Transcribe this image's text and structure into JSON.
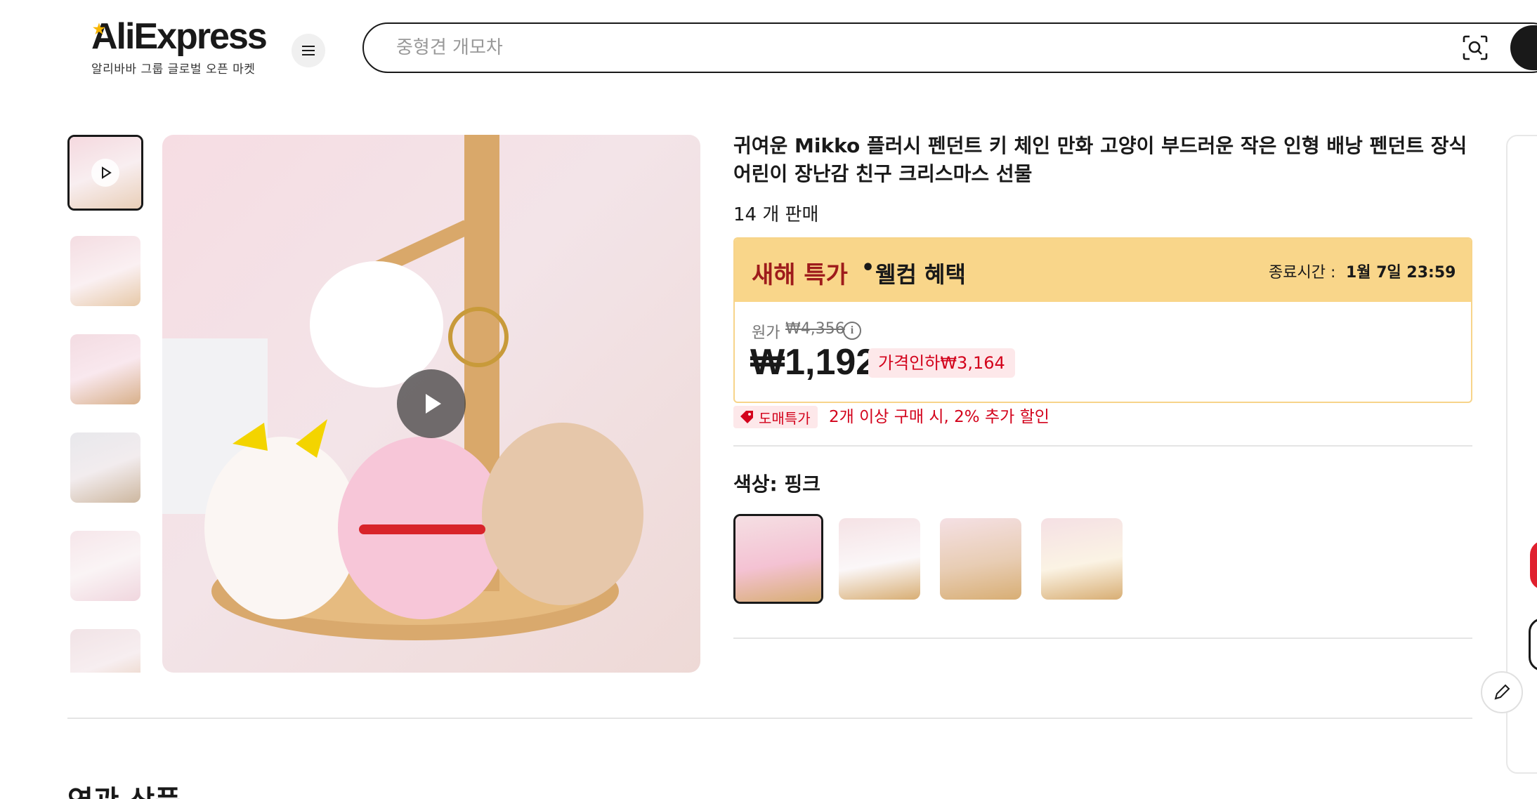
{
  "header": {
    "logo": "AliExpress",
    "logo_tagline": "알리바바 그룹 글로벌 오픈 마켓",
    "search_placeholder": "중형견 개모차"
  },
  "product": {
    "title": "귀여운 Mikko 플러시 펜던트 키 체인 만화 고양이 부드러운 작은 인형 배낭 펜던트 장식 어린이 장난감 친구 크리스마스 선물",
    "sold": "14 개 판매",
    "promo": {
      "label": "새해 특가",
      "separator": "•",
      "welcome": "웰컴 혜택",
      "end_label": "종료시간 :",
      "end_value": "1월 7일 23:59"
    },
    "price": {
      "original_label": "원가",
      "original": "₩4,356",
      "current": "₩1,192",
      "discount": "가격인하₩3,164"
    },
    "bulk": {
      "badge": "도매특가",
      "text": "2개 이상 구매 시, 2% 추가 할인"
    },
    "color": {
      "label": "색상: 핑크",
      "options": [
        "핑크",
        "화이트",
        "브라운",
        "옐로우"
      ],
      "selected": "핑크"
    }
  },
  "related": {
    "heading": "연관 상품"
  },
  "colors": {
    "accent_red": "#d3031c",
    "promo_bg": "#f9d68a",
    "promo_text": "#9e1b1b",
    "text": "#191919"
  }
}
